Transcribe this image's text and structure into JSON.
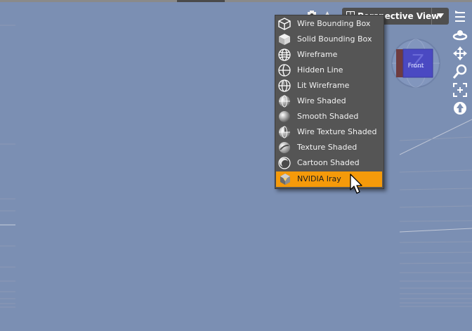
{
  "viewport": {
    "background": "#7b8fb3",
    "view_selector": {
      "label": "Perspective View"
    }
  },
  "draw_style_menu": {
    "items": [
      {
        "label": "Wire Bounding Box",
        "icon": "wire-bounding-box-icon"
      },
      {
        "label": "Solid Bounding Box",
        "icon": "solid-bounding-box-icon"
      },
      {
        "label": "Wireframe",
        "icon": "wireframe-icon"
      },
      {
        "label": "Hidden Line",
        "icon": "hidden-line-icon"
      },
      {
        "label": "Lit Wireframe",
        "icon": "lit-wireframe-icon"
      },
      {
        "label": "Wire Shaded",
        "icon": "wire-shaded-icon"
      },
      {
        "label": "Smooth Shaded",
        "icon": "smooth-shaded-icon"
      },
      {
        "label": "Wire Texture Shaded",
        "icon": "wire-texture-shaded-icon"
      },
      {
        "label": "Texture Shaded",
        "icon": "texture-shaded-icon"
      },
      {
        "label": "Cartoon Shaded",
        "icon": "cartoon-shaded-icon"
      },
      {
        "label": "NVIDIA Iray",
        "icon": "nvidia-iray-icon",
        "selected": true
      }
    ],
    "highlight_color": "#f59a0a"
  },
  "view_cube": {
    "face_label": "Front"
  },
  "right_toolbar": [
    "viewport-options-icon",
    "orbit-icon",
    "pan-icon",
    "zoom-icon",
    "frame-icon",
    "reset-view-icon"
  ]
}
